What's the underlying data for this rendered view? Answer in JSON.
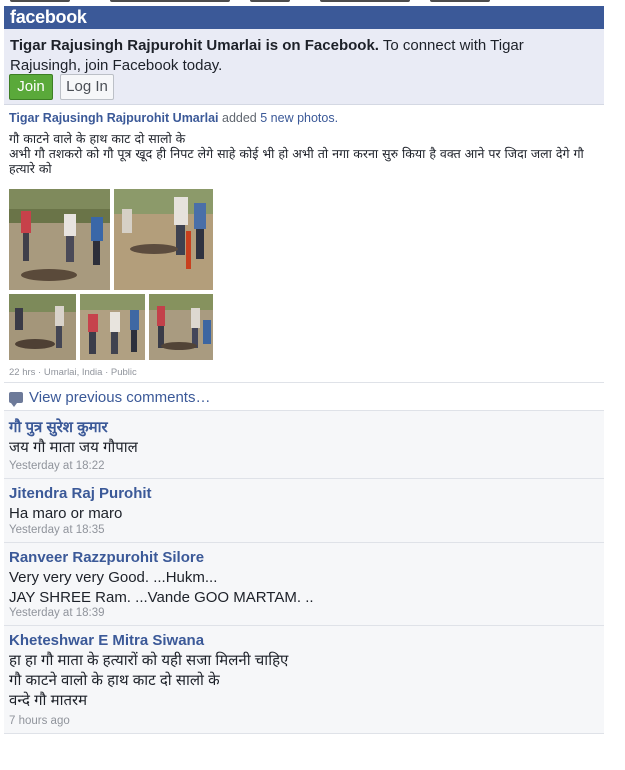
{
  "header": {
    "logo": "facebook"
  },
  "join_box": {
    "bold_text": "Tigar Rajusingh Rajpurohit Umarlai is on Facebook.",
    "text": " To connect with Tigar Rajusingh, join Facebook today.",
    "join_label": "Join",
    "login_label": "Log In"
  },
  "post": {
    "author": "Tigar Rajusingh Rajpurohit Umarlai",
    "action": " added ",
    "photos_link": "5 new photos.",
    "text_line1": "गौ काटने वाले के हाथ काट दो सालो के",
    "text_line2": "अभी गौ तशकरो को गौ पूत्र खूद ही निपट लेगे साहे कोई भी हो अभी तो नगा करना सुरु किया है वक्त आने पर जिदा जला देगे गौ हत्यारे को",
    "meta": "22 hrs · Umarlai, India · Public"
  },
  "comments_section": {
    "view_previous": "View previous comments…"
  },
  "comments": [
    {
      "name": "गौ पुत्र सुरेश कुमार",
      "lines": [
        "जय गौ माता जय गौपाल"
      ],
      "time": "Yesterday at 18:22"
    },
    {
      "name": "Jitendra Raj Purohit",
      "lines": [
        "Ha maro or maro"
      ],
      "time": "Yesterday at 18:35"
    },
    {
      "name": "Ranveer Razzpurohit Silore",
      "lines": [
        "Very very very Good. ...Hukm...",
        "JAY SHREE Ram. ...Vande GOO MARTAM. .."
      ],
      "time": "Yesterday at 18:39"
    },
    {
      "name": "Kheteshwar E Mitra Siwana",
      "lines": [
        "हा हा गौ माता के हत्यारों को यही सजा मिलनी चाहिए",
        "गौ काटने वालो के हाथ काट दो सालो के",
        "वन्दे गौ मातरम"
      ],
      "time": "7 hours ago"
    }
  ]
}
